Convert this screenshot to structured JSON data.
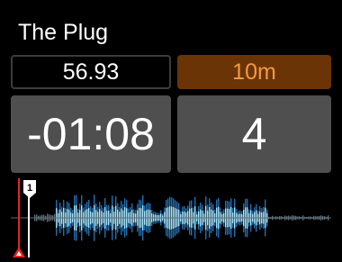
{
  "track": {
    "title": "The Plug"
  },
  "tempo": {
    "bpm": "56.93"
  },
  "pitch_range": {
    "label": "10m"
  },
  "time": {
    "remaining": "-01:08"
  },
  "beat": {
    "value": "4"
  },
  "waveform": {
    "cue_marker_label": "1",
    "playhead_progress": 0.0,
    "colors": {
      "wave_outer": "#1f6fb0",
      "wave_inner": "#a8e6ff",
      "playhead": "#e8231e",
      "cue": "#ffffff",
      "dim": "#5c6e78"
    }
  },
  "colors": {
    "background": "#000000",
    "panel": "#4f4f4f",
    "accent_bg": "#6a3407",
    "accent_text": "#f09a44"
  }
}
